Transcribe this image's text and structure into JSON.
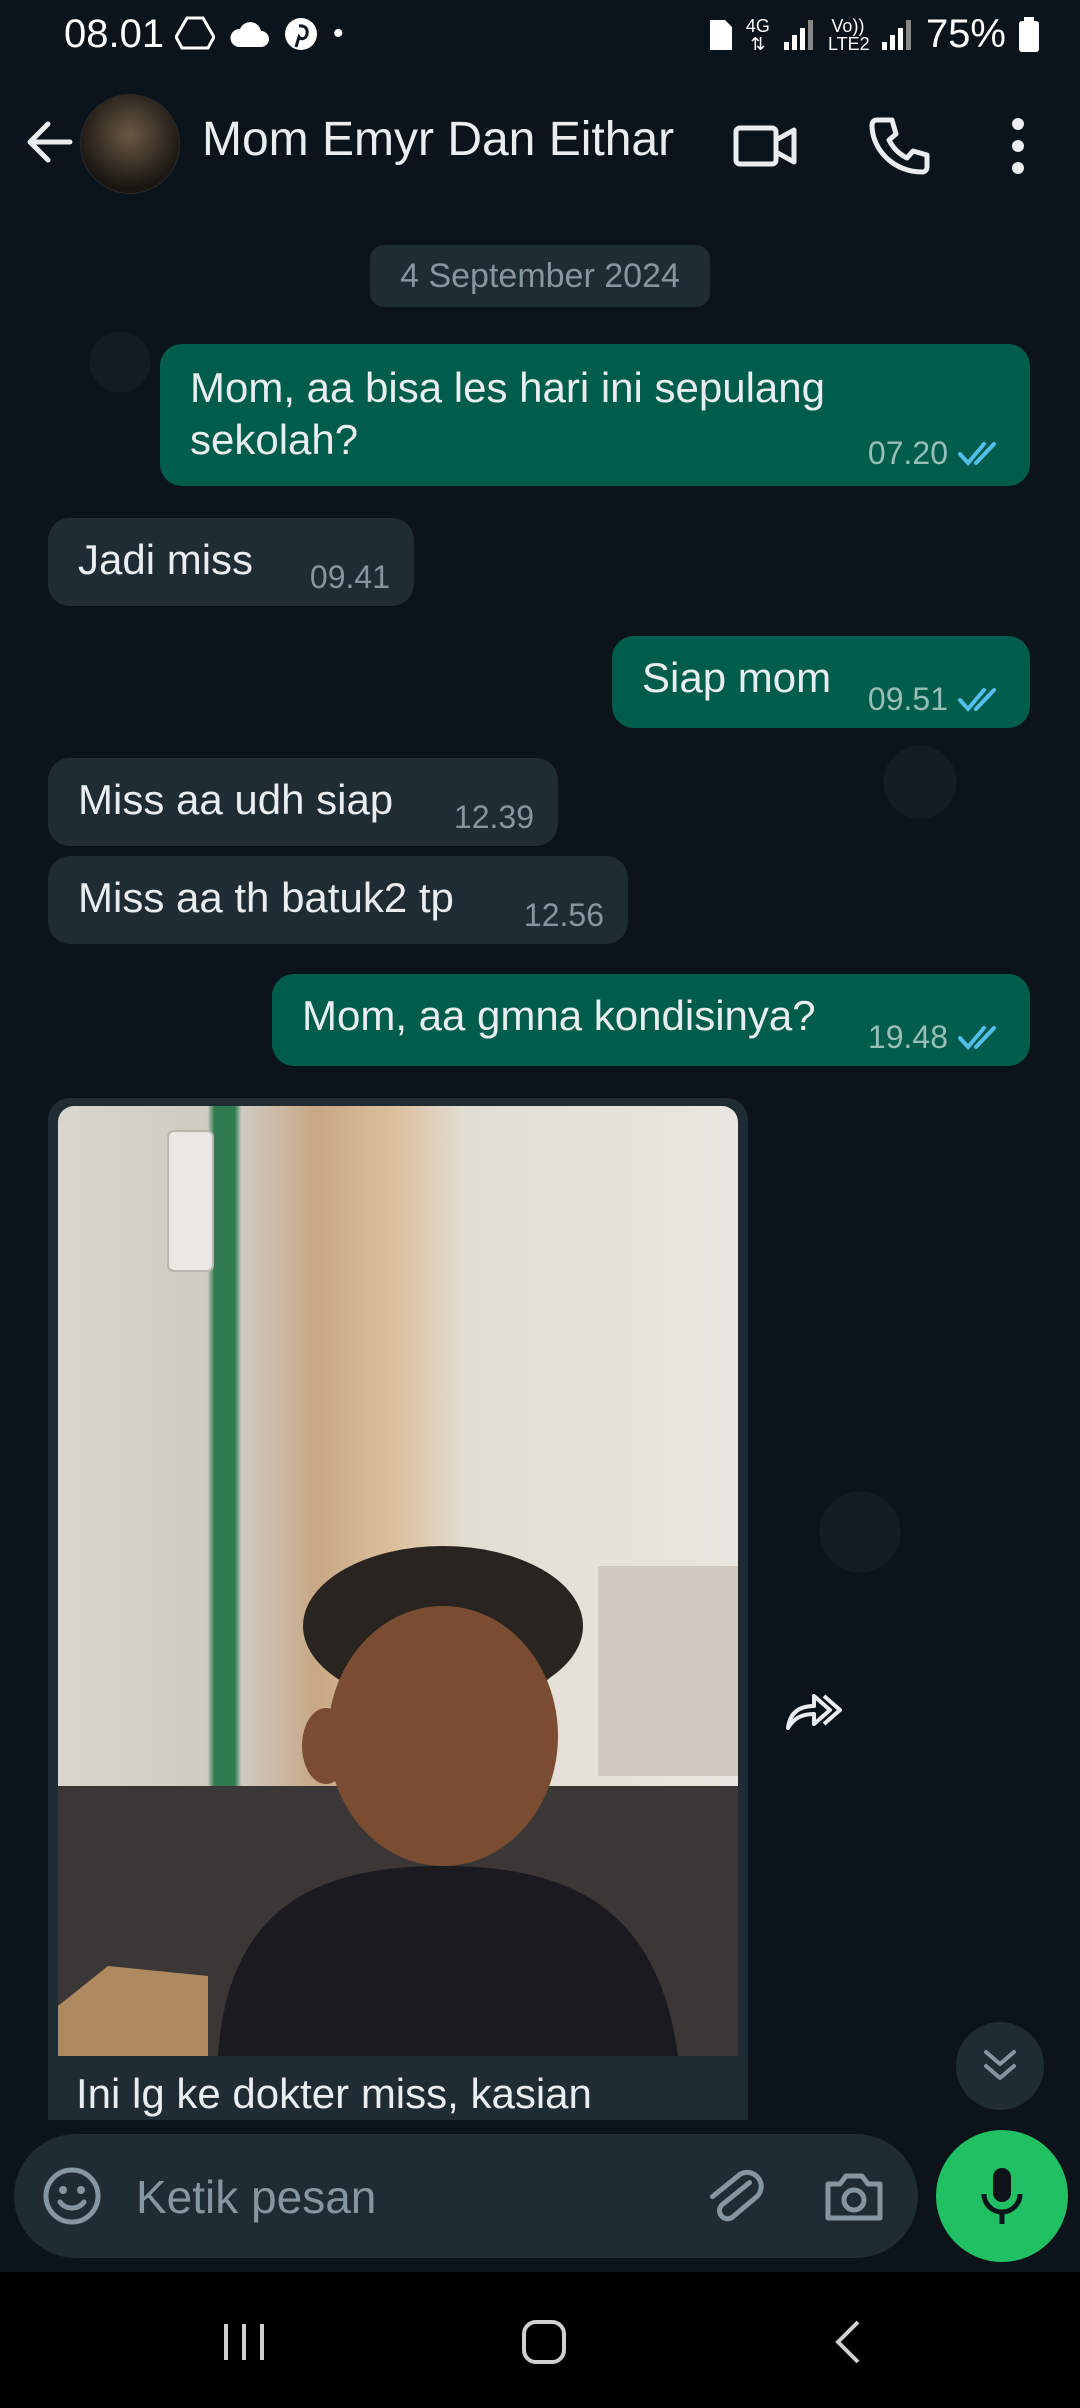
{
  "status_bar": {
    "time": "08.01",
    "network": "4G",
    "sim2": "Vo)) LTE2",
    "battery": "75%"
  },
  "header": {
    "contact_name": "Mom Emyr Dan Eithar",
    "icons": [
      "back-arrow-icon",
      "video-call-icon",
      "phone-icon",
      "more-vert-icon"
    ]
  },
  "chat": {
    "date_divider": "4 September 2024",
    "messages": [
      {
        "dir": "out",
        "text_line1": "Mom, aa bisa les hari ini sepulang",
        "text_line2": "sekolah?",
        "time": "07.20"
      },
      {
        "dir": "in",
        "text": "Jadi miss",
        "time": "09.41"
      },
      {
        "dir": "out",
        "text": "Siap mom",
        "time": "09.51"
      },
      {
        "dir": "in",
        "text": "Miss aa udh siap",
        "time": "12.39"
      },
      {
        "dir": "in",
        "text": "Miss aa th batuk2 tp",
        "time": "12.56"
      },
      {
        "dir": "out",
        "text": "Mom, aa gmna kondisinya?",
        "time": "19.48"
      }
    ],
    "photo_caption": "Ini lg ke dokter miss, kasian"
  },
  "composer": {
    "placeholder": "Ketik pesan"
  },
  "colors": {
    "background": "#0b141a",
    "outgoing_bubble": "#005c4b",
    "incoming_bubble": "#202c33",
    "mic_button": "#21c063",
    "read_ticks": "#53bdeb"
  }
}
